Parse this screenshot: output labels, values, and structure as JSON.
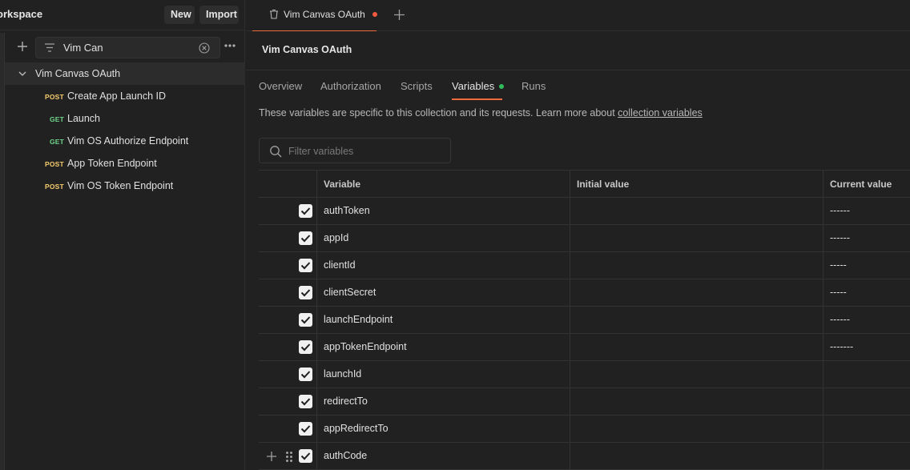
{
  "workspace": {
    "title": "orkspace",
    "new_label": "New",
    "import_label": "Import"
  },
  "sidebar": {
    "filter_value": "Vim Can",
    "collection": {
      "name": "Vim Canvas OAuth",
      "requests": [
        {
          "method": "POST",
          "name": "Create App Launch ID"
        },
        {
          "method": "GET",
          "name": "Launch"
        },
        {
          "method": "GET",
          "name": "Vim OS Authorize Endpoint"
        },
        {
          "method": "POST",
          "name": "App Token Endpoint"
        },
        {
          "method": "POST",
          "name": "Vim OS Token Endpoint"
        }
      ]
    }
  },
  "tab": {
    "label": "Vim Canvas OAuth"
  },
  "collection_title": "Vim Canvas OAuth",
  "subtabs": [
    "Overview",
    "Authorization",
    "Scripts",
    "Variables",
    "Runs"
  ],
  "description": {
    "text": "These variables are specific to this collection and its requests. Learn more about ",
    "link": "collection variables"
  },
  "search": {
    "placeholder": "Filter variables"
  },
  "table": {
    "headers": {
      "variable": "Variable",
      "initial": "Initial value",
      "current": "Current value"
    },
    "rows": [
      {
        "variable": "authToken",
        "initial": "",
        "current": "------"
      },
      {
        "variable": "appId",
        "initial": "",
        "current": "------"
      },
      {
        "variable": "clientId",
        "initial": "",
        "current": "-----"
      },
      {
        "variable": "clientSecret",
        "initial": "",
        "current": "-----"
      },
      {
        "variable": "launchEndpoint",
        "initial": "",
        "current": "------"
      },
      {
        "variable": "appTokenEndpoint",
        "initial": "",
        "current": "-------"
      },
      {
        "variable": "launchId",
        "initial": "",
        "current": ""
      },
      {
        "variable": "redirectTo",
        "initial": "",
        "current": ""
      },
      {
        "variable": "appRedirectTo",
        "initial": "",
        "current": ""
      },
      {
        "variable": "authCode",
        "initial": "",
        "current": ""
      }
    ]
  },
  "colors": {
    "accent": "#ef6a3c",
    "post": "#f6cd6d",
    "get": "#6fd58b",
    "active_dot": "#2fbd5c",
    "unsaved_dot": "#ef5b3f"
  }
}
